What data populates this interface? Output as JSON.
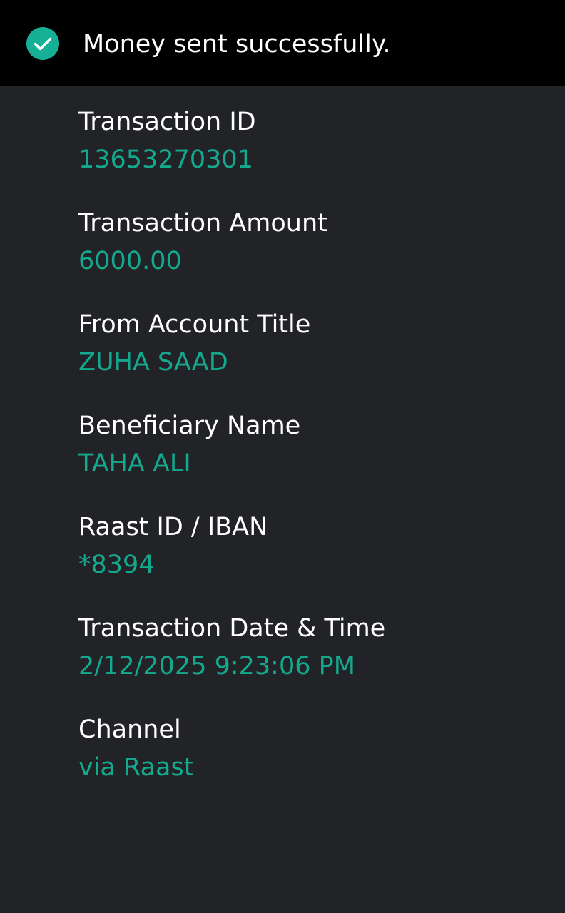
{
  "banner": {
    "icon": "check-circle-icon",
    "icon_color": "#16b096",
    "message": "Money sent successfully."
  },
  "colors": {
    "background": "#222326",
    "banner_background": "#000000",
    "label": "#ffffff",
    "value": "#14a98f"
  },
  "details": [
    {
      "label": "Transaction ID",
      "value": "13653270301"
    },
    {
      "label": "Transaction Amount",
      "value": "6000.00"
    },
    {
      "label": "From Account Title",
      "value": "ZUHA SAAD"
    },
    {
      "label": "Beneficiary Name",
      "value": "TAHA ALI"
    },
    {
      "label": "Raast ID / IBAN",
      "value": "*8394"
    },
    {
      "label": "Transaction Date & Time",
      "value": "2/12/2025 9:23:06 PM"
    },
    {
      "label": "Channel",
      "value": "via Raast"
    }
  ]
}
